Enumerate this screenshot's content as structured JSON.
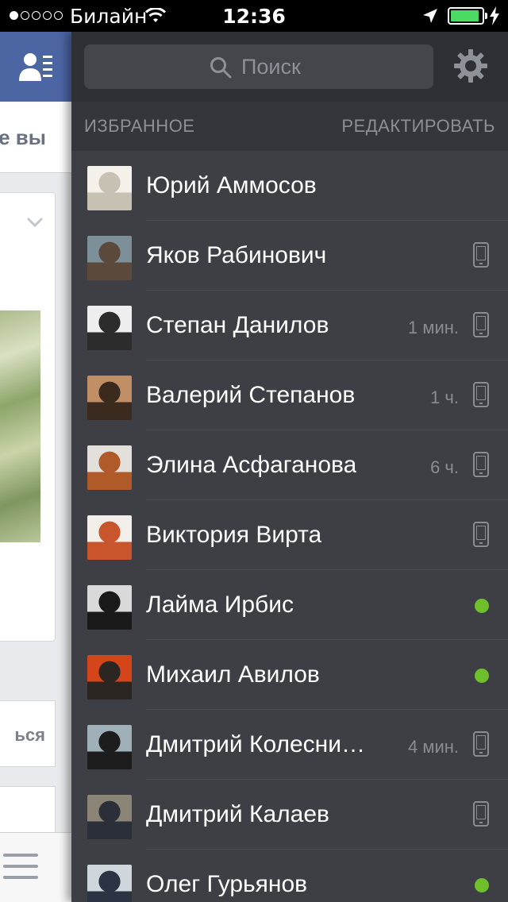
{
  "status_bar": {
    "carrier": "Билайн",
    "time": "12:36",
    "signal_strength": 1,
    "signal_total": 5
  },
  "feed": {
    "tab_fragment": "е вы",
    "bottom_fragment": "ься"
  },
  "chat": {
    "search_placeholder": "Поиск",
    "section_title": "ИЗБРАННОЕ",
    "edit_label": "РЕДАКТИРОВАТЬ",
    "contacts": [
      {
        "name": "Юрий Аммосов",
        "time": "",
        "status": "none",
        "avatar_colors": [
          "#f4f1ea",
          "#c7c1b4"
        ]
      },
      {
        "name": "Яков Рабинович",
        "time": "",
        "status": "mobile",
        "avatar_colors": [
          "#7d8f99",
          "#5b4a3c"
        ]
      },
      {
        "name": "Степан Данилов",
        "time": "1 мин.",
        "status": "mobile",
        "avatar_colors": [
          "#eeeeee",
          "#2c2c2c"
        ]
      },
      {
        "name": "Валерий Степанов",
        "time": "1 ч.",
        "status": "mobile",
        "avatar_colors": [
          "#c08f66",
          "#3b2a1e"
        ]
      },
      {
        "name": "Элина Асфаганова",
        "time": "6 ч.",
        "status": "mobile",
        "avatar_colors": [
          "#e3e0dc",
          "#b05a2a"
        ]
      },
      {
        "name": "Виктория Вирта",
        "time": "",
        "status": "mobile",
        "avatar_colors": [
          "#f2eee9",
          "#c8552b"
        ]
      },
      {
        "name": "Лайма Ирбис",
        "time": "",
        "status": "online",
        "avatar_colors": [
          "#d9d9d9",
          "#1a1a1a"
        ]
      },
      {
        "name": "Михаил Авилов",
        "time": "",
        "status": "online",
        "avatar_colors": [
          "#d5451b",
          "#2b2622"
        ]
      },
      {
        "name": "Дмитрий Колесни…",
        "time": "4 мин.",
        "status": "mobile",
        "avatar_colors": [
          "#9fb0b8",
          "#1d1d1d"
        ]
      },
      {
        "name": "Дмитрий Калаев",
        "time": "",
        "status": "mobile",
        "avatar_colors": [
          "#8b8578",
          "#2a2f3a"
        ]
      },
      {
        "name": "Олег Гурьянов",
        "time": "",
        "status": "online",
        "avatar_colors": [
          "#cfd6dc",
          "#2b3442"
        ]
      }
    ]
  },
  "colors": {
    "feed_header": "#4c66a4",
    "chat_bg": "#3e3f45",
    "online": "#6fbf2c",
    "battery": "#4cd964"
  }
}
